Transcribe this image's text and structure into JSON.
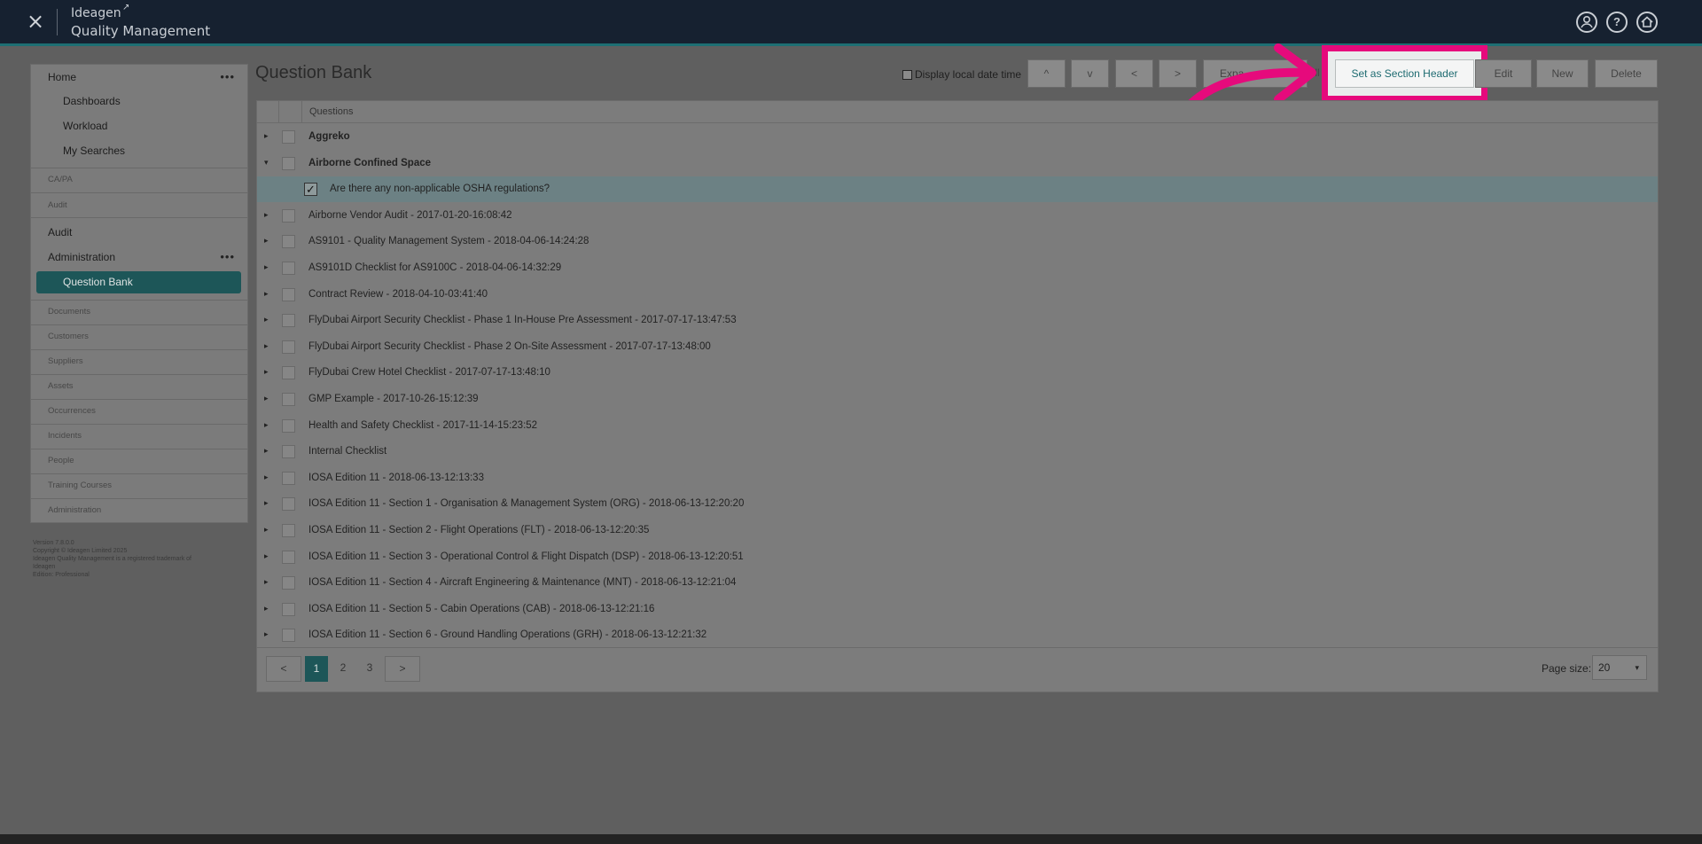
{
  "header": {
    "close_icon": "×",
    "brand_line1": "Ideagen",
    "brand_line2": "Quality Management",
    "icons": [
      "user-icon",
      "help-icon",
      "home-icon"
    ]
  },
  "sidebar": {
    "home": "Home",
    "dashboards": "Dashboards",
    "workload": "Workload",
    "my_searches": "My Searches",
    "capa": "CA/PA",
    "audit_small": "Audit",
    "audit": "Audit",
    "administration": "Administration",
    "question_bank": "Question Bank",
    "documents": "Documents",
    "customers": "Customers",
    "suppliers": "Suppliers",
    "assets": "Assets",
    "occurrences": "Occurrences",
    "incidents": "Incidents",
    "people": "People",
    "training_courses": "Training Courses",
    "administration_small": "Administration",
    "more": "•••"
  },
  "version": {
    "line1": "Version 7.8.0.0",
    "line2": "Copyright © Ideagen Limited 2025",
    "line3": "Ideagen Quality Management is a registered trademark of",
    "line4": "Ideagen",
    "line5": "Edition: Professional"
  },
  "main": {
    "title": "Question Bank",
    "display_local_label": "Display local date time",
    "toolbar": {
      "up": "^",
      "down": "v",
      "left": "<",
      "right": ">",
      "expand": "Expa",
      "all": "All",
      "set_section_header": "Set as Section Header",
      "edit": "Edit",
      "new": "New",
      "delete": "Delete"
    },
    "highlight_color": "#e60a7c",
    "accent": "#1d5658"
  },
  "grid": {
    "column_header": "Questions",
    "rows": [
      {
        "text": "Aggreko",
        "bold": true,
        "expander": "▸"
      },
      {
        "text": "Airborne Confined Space",
        "bold": true,
        "expander": "▾"
      },
      {
        "text": "Are there any non-applicable OSHA regulations?",
        "selected": true,
        "check": "✓"
      },
      {
        "text": "Airborne Vendor Audit - 2017-01-20-16:08:42",
        "expander": "▸"
      },
      {
        "text": "AS9101 - Quality Management System - 2018-04-06-14:24:28",
        "expander": "▸"
      },
      {
        "text": "AS9101D Checklist for AS9100C - 2018-04-06-14:32:29",
        "expander": "▸"
      },
      {
        "text": "Contract Review - 2018-04-10-03:41:40",
        "expander": "▸"
      },
      {
        "text": "FlyDubai Airport Security Checklist - Phase 1 In-House Pre Assessment - 2017-07-17-13:47:53",
        "expander": "▸"
      },
      {
        "text": "FlyDubai Airport Security Checklist - Phase 2 On-Site Assessment - 2017-07-17-13:48:00",
        "expander": "▸"
      },
      {
        "text": "FlyDubai Crew Hotel Checklist - 2017-07-17-13:48:10",
        "expander": "▸"
      },
      {
        "text": "GMP Example - 2017-10-26-15:12:39",
        "expander": "▸"
      },
      {
        "text": "Health and Safety Checklist - 2017-11-14-15:23:52",
        "expander": "▸"
      },
      {
        "text": "Internal Checklist",
        "expander": "▸"
      },
      {
        "text": "IOSA Edition 11 - 2018-06-13-12:13:33",
        "expander": "▸"
      },
      {
        "text": "IOSA Edition 11 - Section 1 - Organisation & Management System (ORG) - 2018-06-13-12:20:20",
        "expander": "▸"
      },
      {
        "text": "IOSA Edition 11 - Section 2 - Flight Operations (FLT) - 2018-06-13-12:20:35",
        "expander": "▸"
      },
      {
        "text": "IOSA Edition 11 - Section 3 - Operational Control & Flight Dispatch (DSP) - 2018-06-13-12:20:51",
        "expander": "▸"
      },
      {
        "text": "IOSA Edition 11 - Section 4 - Aircraft Engineering & Maintenance (MNT) - 2018-06-13-12:21:04",
        "expander": "▸"
      },
      {
        "text": "IOSA Edition 11 - Section 5 - Cabin Operations (CAB) - 2018-06-13-12:21:16",
        "expander": "▸"
      },
      {
        "text": "IOSA Edition 11 - Section 6 - Ground Handling Operations (GRH) - 2018-06-13-12:21:32",
        "expander": "▸"
      }
    ]
  },
  "pager": {
    "prev": "<",
    "pages": [
      "1",
      "2",
      "3"
    ],
    "next": ">",
    "page_size_label": "Page size:",
    "page_size": "20",
    "caret": "▾"
  }
}
